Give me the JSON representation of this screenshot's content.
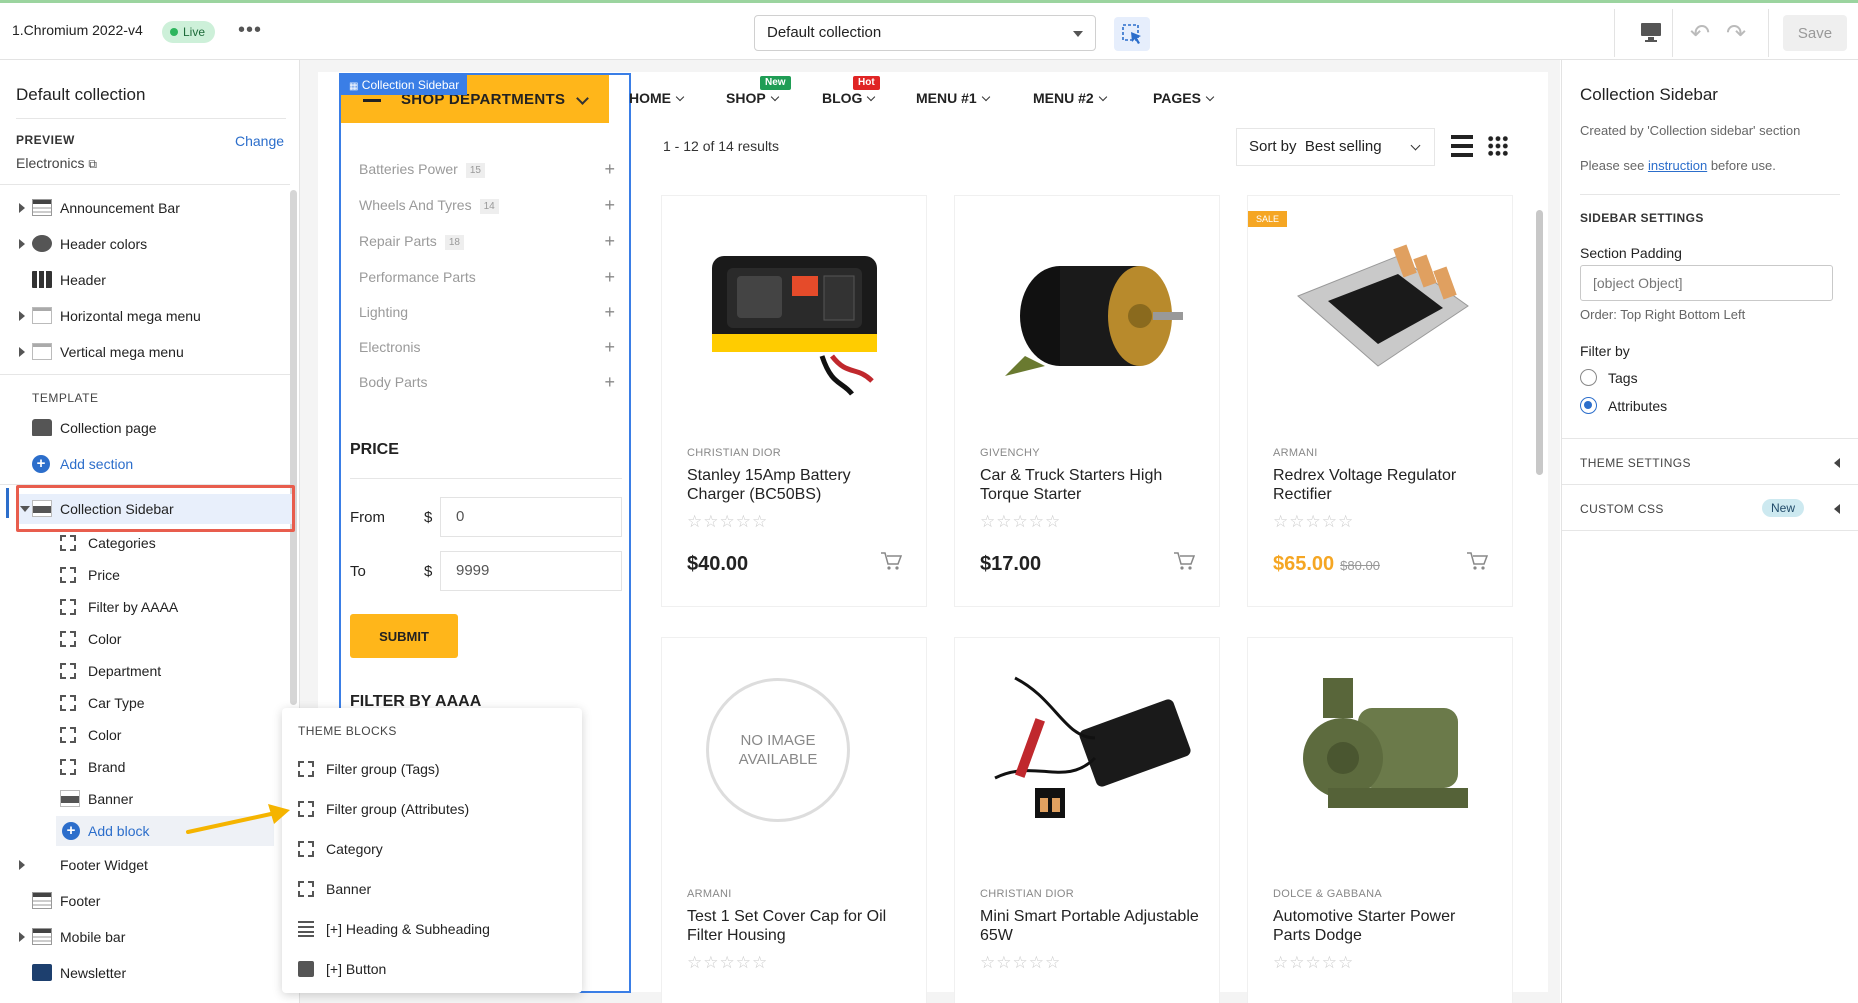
{
  "topbar": {
    "app_title": "1.Chromium 2022-v4",
    "live_label": "Live",
    "collection_select": "Default collection",
    "save_label": "Save"
  },
  "left_panel": {
    "title": "Default collection",
    "preview_label": "PREVIEW",
    "preview_value": "Electronics",
    "change_label": "Change",
    "sections": [
      {
        "label": "Announcement Bar",
        "icon": "announcement-bar-icon"
      },
      {
        "label": "Header colors",
        "icon": "palette-icon"
      },
      {
        "label": "Header",
        "icon": "header-icon"
      },
      {
        "label": "Horizontal mega menu",
        "icon": "mega-menu-icon"
      },
      {
        "label": "Vertical mega menu",
        "icon": "mega-menu-icon"
      }
    ],
    "template_label": "TEMPLATE",
    "collection_page": "Collection page",
    "add_section": "Add section",
    "collection_sidebar": "Collection Sidebar",
    "blocks": [
      "Categories",
      "Price",
      "Filter by AAAA",
      "Color",
      "Department",
      "Car Type",
      "Color",
      "Brand",
      "Banner"
    ],
    "add_block": "Add block",
    "footer_sections": [
      {
        "label": "Footer Widget"
      },
      {
        "label": "Footer"
      },
      {
        "label": "Mobile bar"
      },
      {
        "label": "Newsletter"
      }
    ]
  },
  "theme_blocks": {
    "label": "THEME BLOCKS",
    "items": [
      {
        "label": "Filter group (Tags)",
        "icon": "dashed-square-icon"
      },
      {
        "label": "Filter group (Attributes)",
        "icon": "dashed-square-icon"
      },
      {
        "label": "Category",
        "icon": "dashed-square-icon"
      },
      {
        "label": "Banner",
        "icon": "dashed-square-icon"
      },
      {
        "label": "[+] Heading & Subheading",
        "icon": "text-lines-icon"
      },
      {
        "label": "[+] Button",
        "icon": "button-icon"
      }
    ]
  },
  "store": {
    "sidebar_tag": "Collection Sidebar",
    "shop_departments": "SHOP DEPARTMENTS",
    "categories": [
      {
        "name": "Batteries Power",
        "count": "15"
      },
      {
        "name": "Wheels And Tyres",
        "count": "14"
      },
      {
        "name": "Repair Parts",
        "count": "18"
      },
      {
        "name": "Performance Parts",
        "count": ""
      },
      {
        "name": "Lighting",
        "count": ""
      },
      {
        "name": "Electronis",
        "count": ""
      },
      {
        "name": "Body Parts",
        "count": ""
      }
    ],
    "price_title": "PRICE",
    "from_label": "From",
    "to_label": "To",
    "currency": "$",
    "from_value": "0",
    "to_value": "9999",
    "submit_label": "SUBMIT",
    "filter_title": "FILTER BY AAAA",
    "nav": [
      {
        "label": "HOME",
        "badge": ""
      },
      {
        "label": "SHOP",
        "badge": "New",
        "badge_color": "#1f9d55"
      },
      {
        "label": "BLOG",
        "badge": "Hot",
        "badge_color": "#e02424"
      },
      {
        "label": "MENU #1",
        "badge": ""
      },
      {
        "label": "MENU #2",
        "badge": ""
      },
      {
        "label": "PAGES",
        "badge": ""
      }
    ],
    "results": "1 - 12 of 14 results",
    "sort_label": "Sort by",
    "sort_value": "Best selling",
    "accent_color": "#ffb61a",
    "products": [
      {
        "brand": "CHRISTIAN DIOR",
        "title": "Stanley 15Amp Battery Charger (BC50BS)",
        "price": "$40.00",
        "old_price": "",
        "sale": false,
        "image": "battery-charger"
      },
      {
        "brand": "GIVENCHY",
        "title": "Car & Truck Starters High Torque Starter",
        "price": "$17.00",
        "old_price": "",
        "sale": false,
        "image": "starter-motor"
      },
      {
        "brand": "ARMANI",
        "title": "Redrex Voltage Regulator Rectifier",
        "price": "$65.00",
        "old_price": "$80.00",
        "sale": true,
        "sale_label": "SALE",
        "image": "voltage-regulator"
      },
      {
        "brand": "ARMANI",
        "title": "Test 1 Set Cover Cap for Oil Filter Housing",
        "price": "",
        "old_price": "",
        "sale": false,
        "image": "no-image",
        "no_image_text": "NO IMAGE AVAILABLE"
      },
      {
        "brand": "CHRISTIAN DIOR",
        "title": "Mini Smart Portable Adjustable 65W",
        "price": "",
        "old_price": "",
        "sale": false,
        "image": "soldering-iron"
      },
      {
        "brand": "DOLCE & GABBANA",
        "title": "Automotive Starter Power Parts Dodge",
        "price": "",
        "old_price": "",
        "sale": false,
        "image": "water-pump"
      }
    ]
  },
  "right_panel": {
    "title": "Collection Sidebar",
    "created_by": "Created by 'Collection sidebar' section",
    "please_see": "Please see",
    "instruction_link": "instruction",
    "before_use": "before use.",
    "sidebar_settings": "SIDEBAR SETTINGS",
    "section_padding_label": "Section Padding",
    "section_padding_value": "[object Object]",
    "order_hint": "Order: Top Right Bottom Left",
    "filter_by_label": "Filter by",
    "filter_options": [
      {
        "label": "Tags",
        "selected": false
      },
      {
        "label": "Attributes",
        "selected": true
      }
    ],
    "theme_settings": "THEME SETTINGS",
    "custom_css": "CUSTOM CSS",
    "new_badge": "New"
  }
}
